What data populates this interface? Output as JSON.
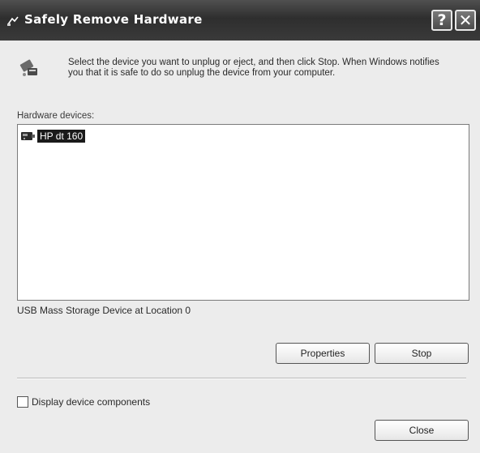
{
  "window": {
    "title": "Safely Remove Hardware",
    "help_button": "?",
    "close_button": "✕"
  },
  "instructions": "Select the device you want to unplug or eject, and then click Stop. When Windows notifies you that it is safe to do so unplug the device from your computer.",
  "hardware_list": {
    "label": "Hardware devices:",
    "items": [
      {
        "label": "HP dt 160",
        "icon": "usb-device-icon",
        "selected": true
      }
    ]
  },
  "device_description": "USB Mass Storage Device at Location 0",
  "buttons": {
    "properties": "Properties",
    "stop": "Stop",
    "close": "Close"
  },
  "options": {
    "display_components": {
      "label": "Display device components",
      "checked": false
    }
  },
  "colors": {
    "selection": "#1a1a1a",
    "titlebar": "#3a3a3a"
  }
}
